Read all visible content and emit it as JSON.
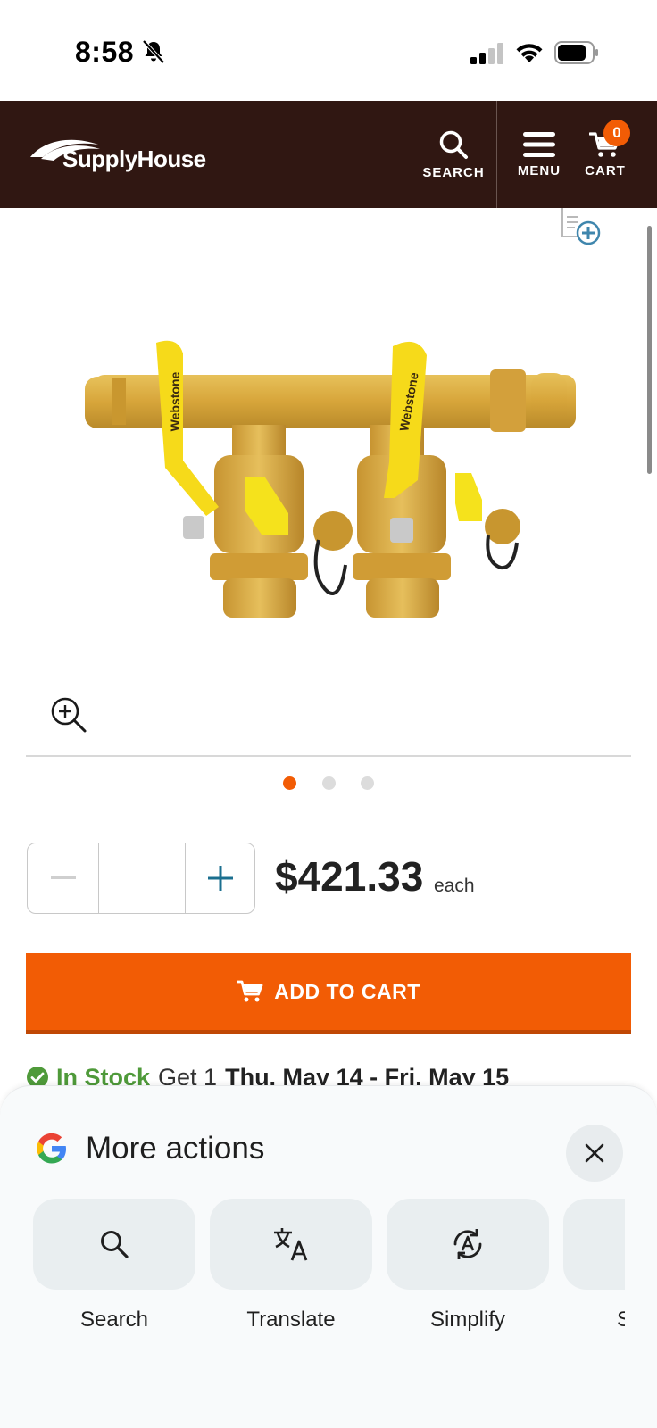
{
  "status_bar": {
    "time": "8:58"
  },
  "header": {
    "logo_text": "SupplyHouse",
    "search_label": "SEARCH",
    "menu_label": "MENU",
    "cart_label": "CART",
    "cart_count": "0"
  },
  "product": {
    "brand_marks": [
      "Webstone",
      "Webstone"
    ],
    "carousel": {
      "total": 3,
      "active": 1
    },
    "quantity": {
      "value": ""
    },
    "price": "$421.33",
    "price_unit": "each",
    "add_to_cart_label": "ADD TO CART",
    "stock": {
      "status": "In Stock",
      "get_text": "Get 1",
      "dates": "Thu. May 14 - Fri. May 15"
    }
  },
  "more_actions": {
    "title": "More actions",
    "actions": [
      {
        "label": "Search",
        "icon": "search-icon"
      },
      {
        "label": "Translate",
        "icon": "translate-icon"
      },
      {
        "label": "Simplify",
        "icon": "simplify-icon"
      },
      {
        "label": "S",
        "icon": "partial-icon"
      }
    ]
  },
  "colors": {
    "header_bg": "#301712",
    "accent": "#f25c05",
    "in_stock": "#4f9a3a",
    "plus_blue": "#1b6f8f"
  }
}
